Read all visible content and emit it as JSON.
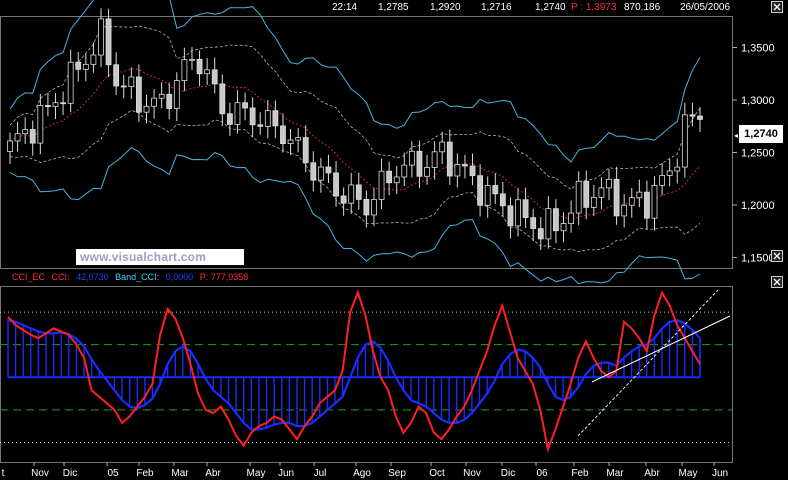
{
  "header": {
    "time": "22:14",
    "open": "1,2785",
    "high": "1,2920",
    "low": "1,2716",
    "close": "1,2740",
    "p_label": "P : 1,3973",
    "volume": "870.186",
    "date": "26/05/2006"
  },
  "watermark": "www.visualchart.com",
  "price_marker": "1,2740",
  "legend": {
    "cci_label": "CCI_EC",
    "cci_field": "CCI:",
    "cci_value": "42,0730",
    "band_label": "Band_CCI:",
    "band_value": "0,0000",
    "p_value": "P: 777,9358"
  },
  "colors": {
    "candle_up": "#ffffff",
    "candle_down": "#c8c8c8",
    "bollinger": "#46b4e6",
    "envelope": "#b4b4b4",
    "moving_average": "#d22828",
    "cci_line": "#ff2020",
    "cci_histogram": "#1a2cff",
    "cci_avg": "#1a2cff",
    "guide_green": "#1ea01e",
    "guide_dotted": "#cccccc",
    "trendline": "#ffffff"
  },
  "chart_data": [
    {
      "type": "candlestick",
      "name": "price",
      "ylim": [
        1.14,
        1.38
      ],
      "y_ticks": [
        "1,3500",
        "1,3000",
        "1,2500",
        "1,2000",
        "1,1500"
      ],
      "bands": [
        "upper_bollinger",
        "lower_bollinger",
        "upper_envelope",
        "lower_envelope",
        "moving_average"
      ]
    },
    {
      "type": "line",
      "name": "CCI",
      "x_ticks": [
        "t",
        "Nov",
        "Dic",
        "05",
        "Feb",
        "Mar",
        "Abr",
        "May",
        "Jun",
        "Jul",
        "Ago",
        "Sep",
        "Oct",
        "Nov",
        "Dic",
        "06",
        "Feb",
        "Mar",
        "Abr",
        "May",
        "Jun"
      ],
      "series": [
        {
          "name": "CCI",
          "values": [
            185,
            160,
            145,
            130,
            120,
            135,
            150,
            140,
            130,
            100,
            60,
            -40,
            -60,
            -80,
            -100,
            -140,
            -120,
            -90,
            -60,
            -20,
            130,
            210,
            180,
            120,
            40,
            -50,
            -100,
            -110,
            -90,
            -130,
            -180,
            -210,
            -170,
            -150,
            -140,
            -120,
            -130,
            -160,
            -190,
            -150,
            -120,
            -80,
            -60,
            -40,
            20,
            200,
            260,
            190,
            80,
            0,
            -40,
            -120,
            -170,
            -140,
            -90,
            -110,
            -170,
            -190,
            -160,
            -120,
            -90,
            -40,
            20,
            80,
            160,
            220,
            140,
            60,
            20,
            -20,
            -100,
            -220,
            -160,
            -90,
            -20,
            60,
            110,
            60,
            20,
            0,
            20,
            170,
            150,
            120,
            80,
            190,
            260,
            220,
            160,
            120,
            80,
            40
          ]
        },
        {
          "name": "CCI avg",
          "values": [
            175,
            170,
            160,
            150,
            140,
            135,
            135,
            138,
            132,
            118,
            95,
            55,
            20,
            -10,
            -40,
            -70,
            -90,
            -95,
            -85,
            -65,
            -20,
            40,
            80,
            95,
            80,
            40,
            -5,
            -40,
            -60,
            -80,
            -110,
            -140,
            -160,
            -160,
            -155,
            -145,
            -140,
            -140,
            -150,
            -150,
            -140,
            -120,
            -100,
            -80,
            -60,
            0,
            60,
            100,
            110,
            90,
            50,
            0,
            -40,
            -70,
            -80,
            -90,
            -110,
            -130,
            -140,
            -140,
            -130,
            -110,
            -80,
            -50,
            -10,
            40,
            70,
            85,
            80,
            60,
            30,
            -20,
            -60,
            -70,
            -60,
            -30,
            10,
            35,
            45,
            45,
            35,
            60,
            80,
            95,
            100,
            120,
            150,
            170,
            175,
            165,
            145,
            120
          ]
        }
      ],
      "ylim": [
        -260,
        280
      ],
      "guide_levels": [
        200,
        100,
        0,
        -100,
        -200
      ]
    }
  ]
}
